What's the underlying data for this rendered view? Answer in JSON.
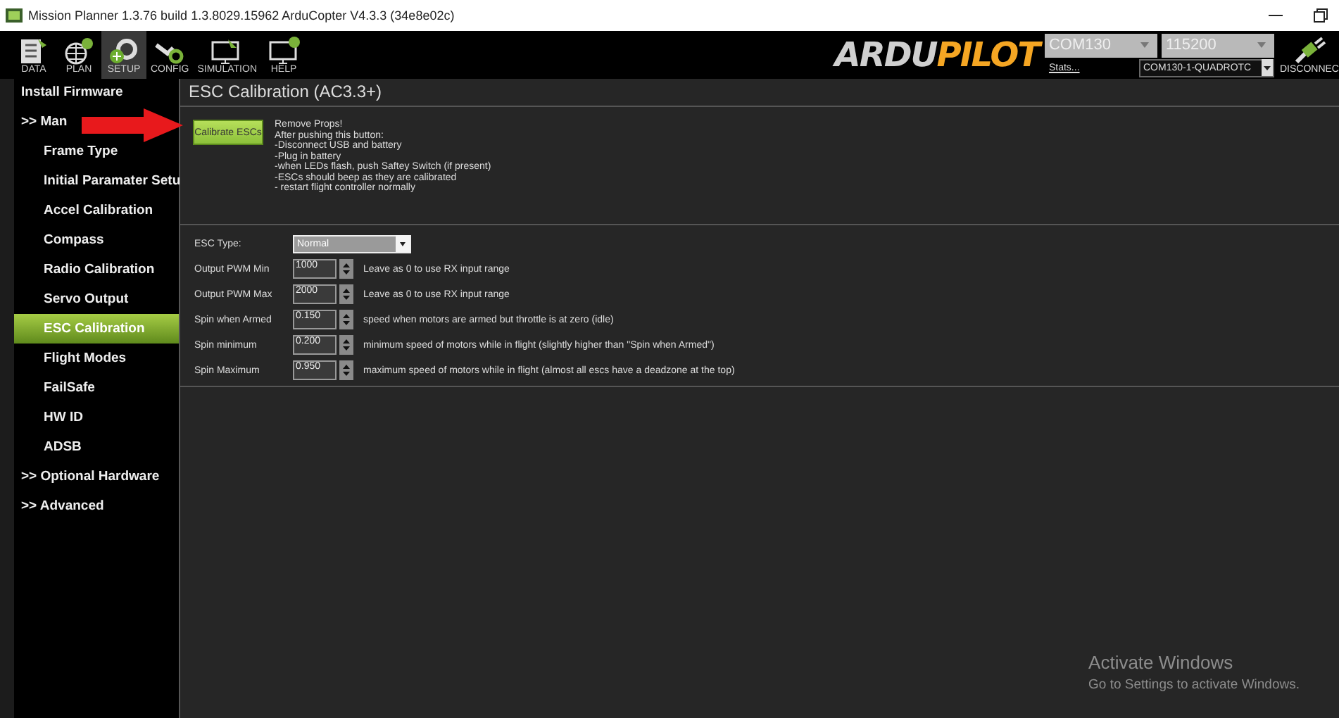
{
  "window": {
    "title": "Mission Planner 1.3.76 build 1.3.8029.15962 ArduCopter V4.3.3 (34e8e02c)"
  },
  "toolbar": [
    {
      "label": "DATA",
      "kind": "data",
      "selected": false
    },
    {
      "label": "PLAN",
      "kind": "plan",
      "selected": false
    },
    {
      "label": "SETUP",
      "kind": "setup",
      "selected": true
    },
    {
      "label": "CONFIG",
      "kind": "config",
      "selected": false
    },
    {
      "label": "SIMULATION",
      "kind": "simulation",
      "selected": false
    },
    {
      "label": "HELP",
      "kind": "help",
      "selected": false
    }
  ],
  "connection": {
    "logo_left": "ARDU",
    "logo_right": "PILOT",
    "port": "COM130",
    "baud": "115200",
    "stats_link": "Stats...",
    "vehicle": "COM130-1-QUADROTC",
    "connect_label": "DISCONNEC"
  },
  "sidebar": {
    "items": [
      {
        "label": "Install Firmware",
        "selected": false
      },
      {
        "label": ">> Man",
        "selected": false,
        "children": [
          {
            "label": "Frame Type",
            "selected": false
          },
          {
            "label": "Initial Paramater Setu",
            "selected": false
          },
          {
            "label": "Accel Calibration",
            "selected": false
          },
          {
            "label": "Compass",
            "selected": false
          },
          {
            "label": "Radio Calibration",
            "selected": false
          },
          {
            "label": "Servo Output",
            "selected": false
          },
          {
            "label": "ESC Calibration",
            "selected": true
          },
          {
            "label": "Flight Modes",
            "selected": false
          },
          {
            "label": "FailSafe",
            "selected": false
          },
          {
            "label": "HW ID",
            "selected": false
          },
          {
            "label": "ADSB",
            "selected": false
          }
        ]
      },
      {
        "label": ">> Optional Hardware",
        "selected": false
      },
      {
        "label": ">> Advanced",
        "selected": false
      }
    ]
  },
  "panel": {
    "title": "ESC Calibration (AC3.3+)",
    "calibrate_button": "Calibrate ESCs",
    "instructions": [
      "Remove Props!",
      "After pushing this button:",
      "-Disconnect USB and battery",
      "-Plug in battery",
      "-when LEDs flash, push Saftey Switch (if present)",
      "-ESCs should beep as they are calibrated",
      "- restart flight controller normally"
    ],
    "esc_type": {
      "label": "ESC Type:",
      "value": "Normal"
    },
    "params": [
      {
        "label": "Output PWM Min",
        "value": "1000",
        "hint": "Leave as 0 to use RX input range"
      },
      {
        "label": "Output PWM Max",
        "value": "2000",
        "hint": "Leave as 0 to use RX input range"
      },
      {
        "label": "Spin when Armed",
        "value": "0.150",
        "hint": "speed when motors are armed but throttle is at zero (idle)"
      },
      {
        "label": "Spin minimum",
        "value": "0.200",
        "hint": "minimum speed of motors while in flight (slightly higher than \"Spin when Armed\")"
      },
      {
        "label": "Spin Maximum",
        "value": "0.950",
        "hint": "maximum speed of motors while in flight (almost all escs have a deadzone at the top)"
      }
    ]
  },
  "os_notice": {
    "title": "Activate Windows",
    "text": "Go to Settings to activate Windows."
  }
}
